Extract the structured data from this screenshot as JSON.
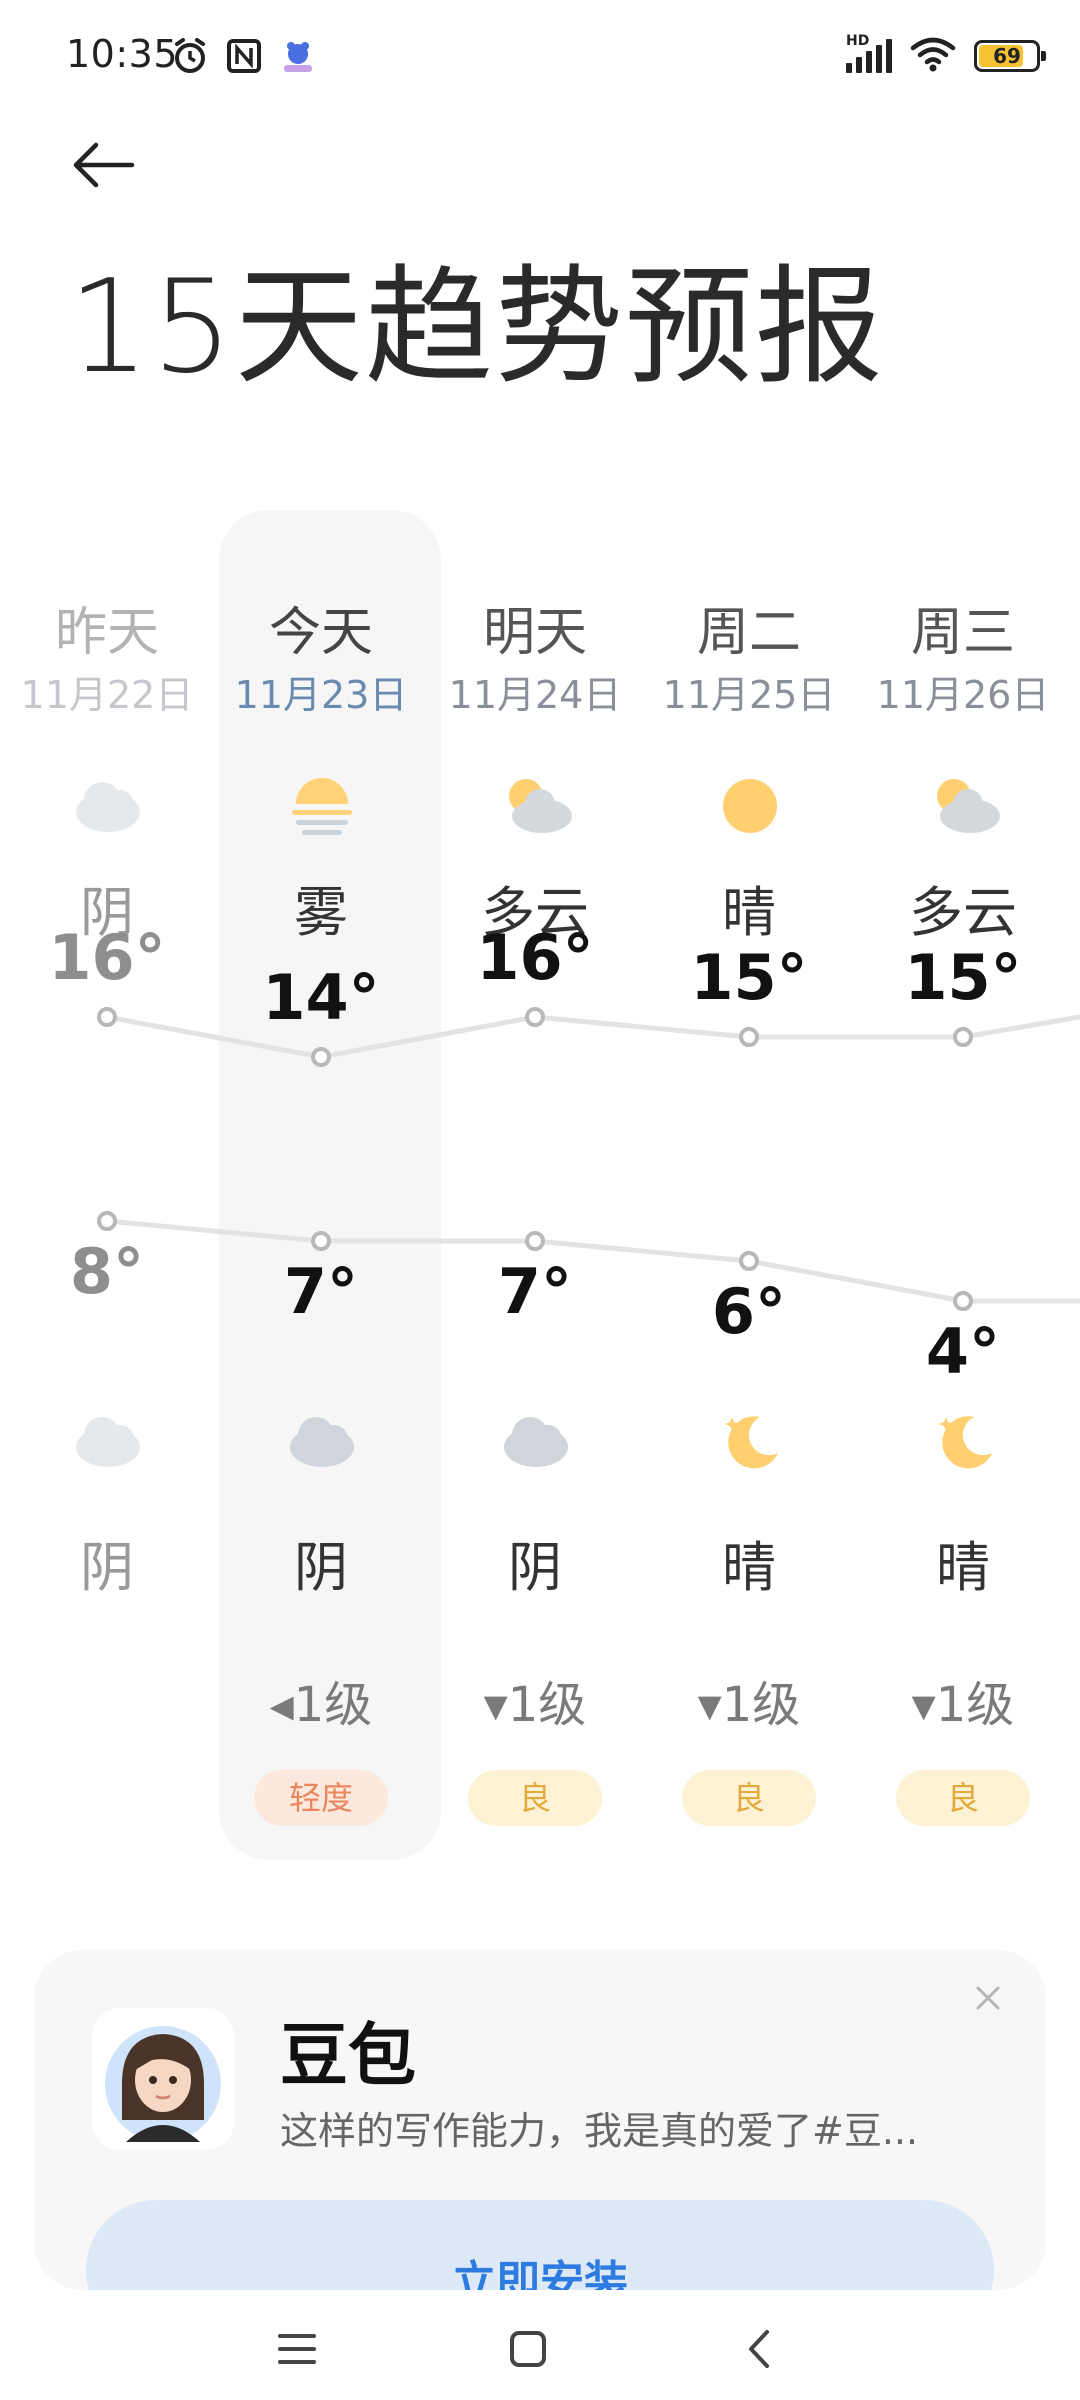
{
  "status_bar": {
    "time": "10:35",
    "left_icons": [
      "alarm-icon",
      "nfc-icon",
      "app-notification-icon"
    ],
    "right_icons": [
      "hd-signal-icon",
      "wifi-icon",
      "battery-icon"
    ],
    "hd_label": "HD",
    "battery_level": "69",
    "battery_color": "#f5c232"
  },
  "header": {
    "back_icon": "back-arrow-icon",
    "title": "15天趋势预报"
  },
  "days": [
    {
      "name": "昨天",
      "date": "11月22日",
      "day_weather": "阴",
      "day_icon": "cloudy-icon",
      "high": "16°",
      "low": "8°",
      "night_weather": "阴",
      "night_icon": "cloudy-icon",
      "wind": "",
      "aqi": ""
    },
    {
      "name": "今天",
      "date": "11月23日",
      "day_weather": "雾",
      "day_icon": "fog-icon",
      "high": "14°",
      "low": "7°",
      "night_weather": "阴",
      "night_icon": "cloudy-icon",
      "wind": "◂1级",
      "aqi": "轻度"
    },
    {
      "name": "明天",
      "date": "11月24日",
      "day_weather": "多云",
      "day_icon": "partly-cloudy-icon",
      "high": "16°",
      "low": "7°",
      "night_weather": "阴",
      "night_icon": "cloudy-icon",
      "wind": "▾1级",
      "aqi": "良"
    },
    {
      "name": "周二",
      "date": "11月25日",
      "day_weather": "晴",
      "day_icon": "sunny-icon",
      "high": "15°",
      "low": "6°",
      "night_weather": "晴",
      "night_icon": "moon-icon",
      "wind": "▾1级",
      "aqi": "良"
    },
    {
      "name": "周三",
      "date": "11月26日",
      "day_weather": "多云",
      "day_icon": "partly-cloudy-icon",
      "high": "15°",
      "low": "4°",
      "night_weather": "晴",
      "night_icon": "moon-icon",
      "wind": "▾1级",
      "aqi": "良"
    }
  ],
  "chart_data": {
    "type": "line",
    "categories": [
      "11月22日",
      "11月23日",
      "11月24日",
      "11月25日",
      "11月26日"
    ],
    "series": [
      {
        "values": [
          16,
          14,
          16,
          15,
          15
        ]
      },
      {
        "values": [
          8,
          7,
          7,
          6,
          4
        ]
      }
    ],
    "colors": {
      "line": "#e3e3e3",
      "point_stroke": "#b8b8b8"
    }
  },
  "ad": {
    "app_name": "豆包",
    "description": "这样的写作能力，我是真的爱了#豆...",
    "install_label": "立即安装",
    "close_icon": "close-icon",
    "avatar_icon": "avatar-icon"
  },
  "nav": {
    "icons": [
      "menu-icon",
      "home-icon",
      "back-icon"
    ]
  },
  "colors": {
    "today_bg": "#f6f6f7",
    "aqi_light_bg": "#fde8de",
    "aqi_light_text": "#e8875c",
    "aqi_good_bg": "#fdf3d4",
    "aqi_good_text": "#e4a93c",
    "install_bg": "#dde9f7",
    "install_text": "#2d7be0"
  }
}
